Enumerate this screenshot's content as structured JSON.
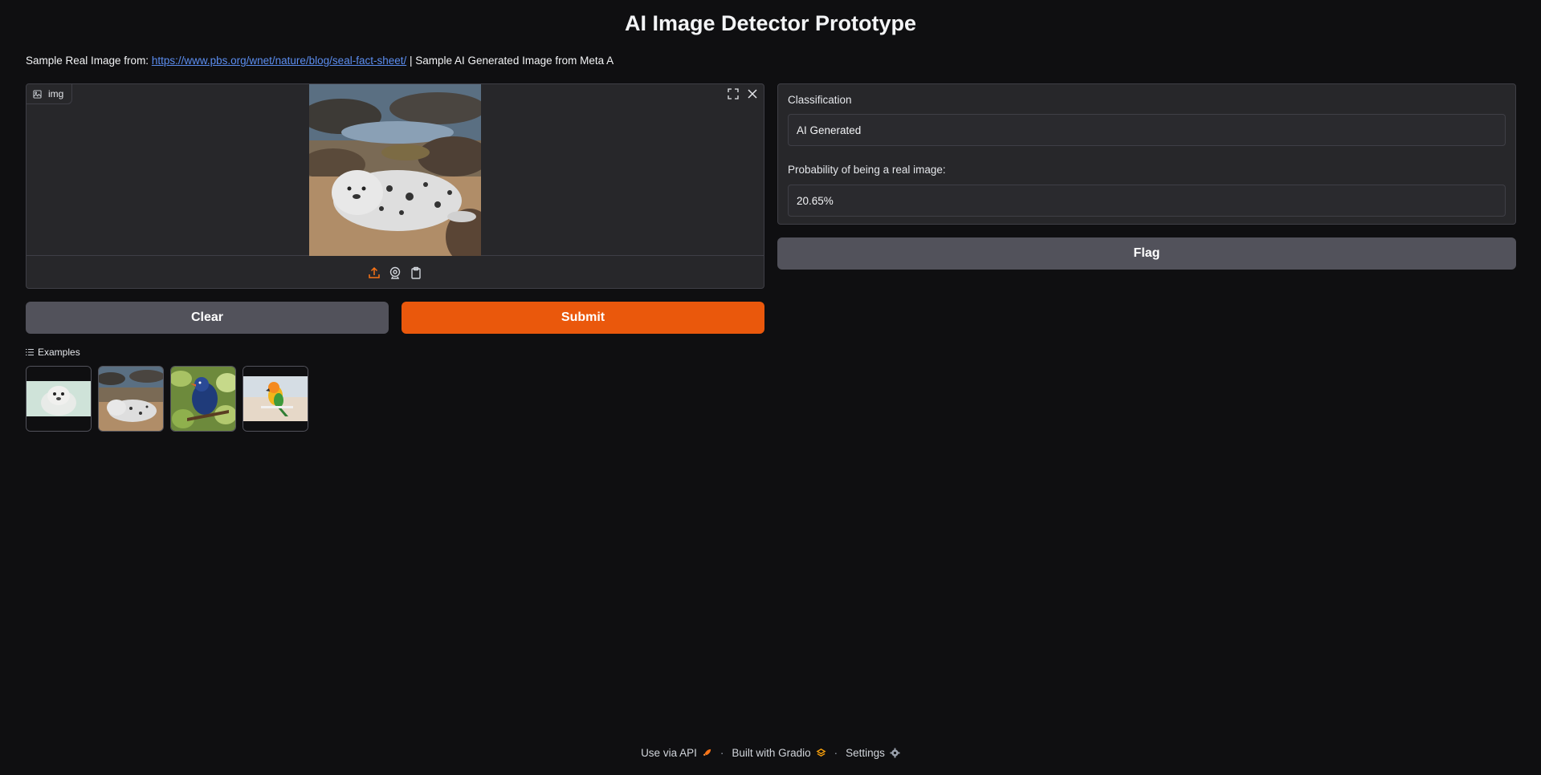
{
  "header": {
    "title": "AI Image Detector Prototype"
  },
  "description": {
    "prefix": "Sample Real Image from: ",
    "link_text": "https://www.pbs.org/wnet/nature/blog/seal-fact-sheet/",
    "suffix": " | Sample AI Generated Image from Meta A"
  },
  "image_input": {
    "label": "img",
    "icons": {
      "label_icon": "image-icon",
      "fullscreen": "fullscreen-icon",
      "close": "close-icon",
      "upload": "upload-icon",
      "webcam": "webcam-icon",
      "clipboard": "clipboard-icon"
    }
  },
  "buttons": {
    "clear": "Clear",
    "submit": "Submit",
    "flag": "Flag"
  },
  "examples": {
    "label": "Examples",
    "items": [
      {
        "name": "seal pup"
      },
      {
        "name": "seal on rocks"
      },
      {
        "name": "blue bird"
      },
      {
        "name": "parrot"
      }
    ]
  },
  "outputs": {
    "classification_label": "Classification",
    "classification_value": "AI Generated",
    "probability_label": "Probability of being a real image:",
    "probability_value": "20.65%"
  },
  "footer": {
    "api": "Use via API",
    "built": "Built with Gradio",
    "settings": "Settings"
  },
  "colors": {
    "background": "#0f0f11",
    "panel": "#27272a",
    "submit": "#ea580c",
    "secondary_button": "#52525b",
    "link": "#5b8def"
  }
}
